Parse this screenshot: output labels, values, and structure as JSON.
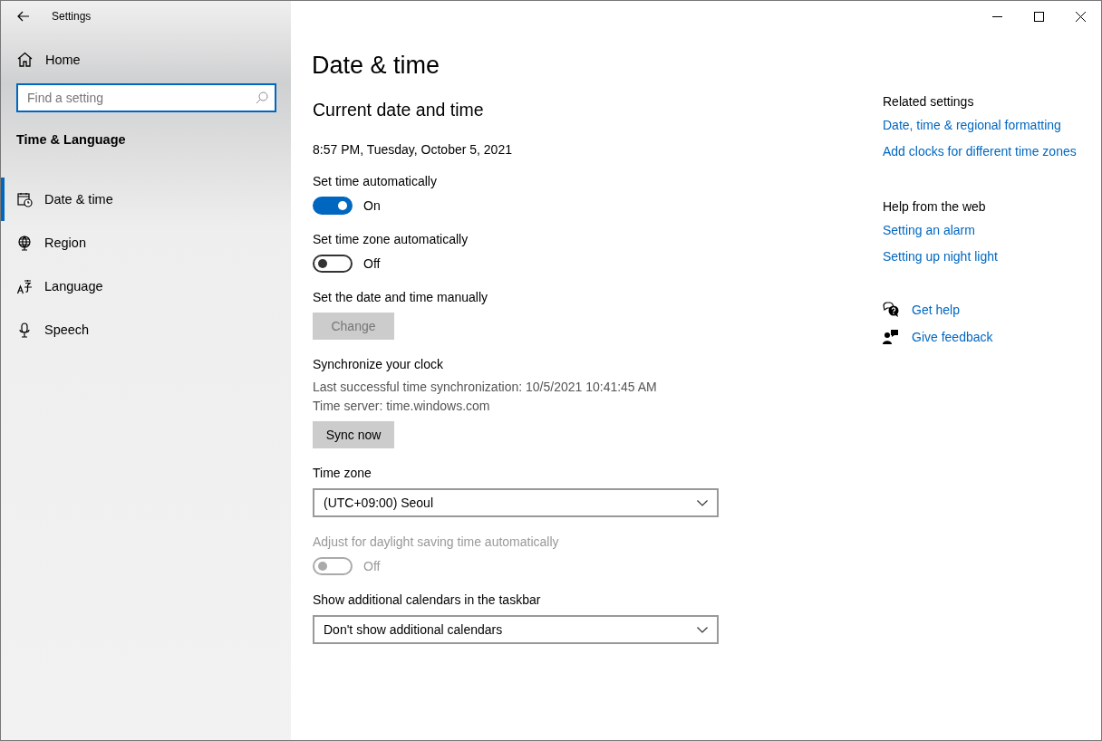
{
  "window": {
    "title": "Settings"
  },
  "sidebar": {
    "home": "Home",
    "search": {
      "placeholder": "Find a setting"
    },
    "section": "Time & Language",
    "items": [
      {
        "label": "Date & time",
        "selected": true
      },
      {
        "label": "Region",
        "selected": false
      },
      {
        "label": "Language",
        "selected": false
      },
      {
        "label": "Speech",
        "selected": false
      }
    ]
  },
  "main": {
    "title": "Date & time",
    "heading": "Current date and time",
    "current": "8:57 PM, Tuesday, October 5, 2021",
    "settings": [
      {
        "kind": "toggle",
        "label": "Set time automatically",
        "on": true,
        "state_text": "On",
        "disabled": false
      },
      {
        "kind": "toggle",
        "label": "Set time zone automatically",
        "on": false,
        "state_text": "Off",
        "disabled": false
      },
      {
        "kind": "button",
        "label": "Set the date and time manually",
        "button": "Change",
        "disabled": true
      },
      {
        "kind": "button",
        "label": "Synchronize your clock",
        "lines": [
          "Last successful time synchronization: 10/5/2021 10:41:45 AM",
          "Time server: time.windows.com"
        ],
        "button": "Sync now",
        "disabled": false
      },
      {
        "kind": "dropdown",
        "label": "Time zone",
        "value": "(UTC+09:00) Seoul"
      },
      {
        "kind": "toggle",
        "label": "Adjust for daylight saving time automatically",
        "on": false,
        "state_text": "Off",
        "disabled": true
      },
      {
        "kind": "dropdown",
        "label": "Show additional calendars in the taskbar",
        "value": "Don't show additional calendars"
      }
    ]
  },
  "aside": {
    "groups": [
      {
        "heading": "Related settings",
        "links": [
          "Date, time & regional formatting",
          "Add clocks for different time zones"
        ]
      },
      {
        "heading": "Help from the web",
        "links": [
          "Setting an alarm",
          "Setting up night light"
        ]
      }
    ],
    "actions": [
      {
        "label": "Get help"
      },
      {
        "label": "Give feedback"
      }
    ]
  }
}
